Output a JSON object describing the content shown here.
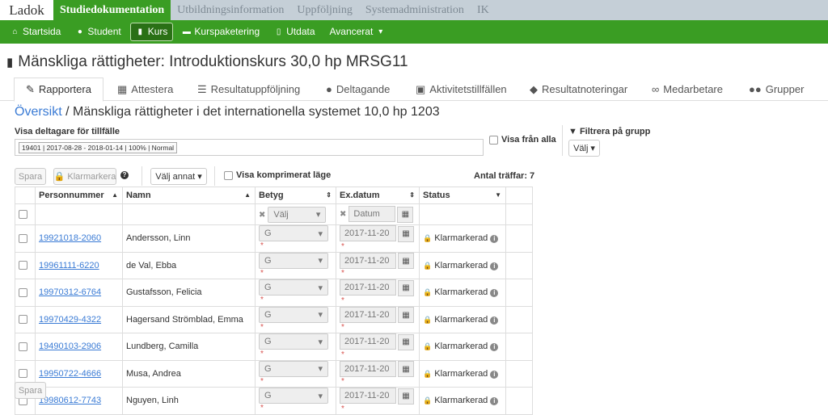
{
  "topnav": {
    "logo": "Ladok",
    "tabs": [
      "Studiedokumentation",
      "Utbildningsinformation",
      "Uppföljning",
      "Systemadministration",
      "IK"
    ]
  },
  "mainnav": {
    "items": [
      {
        "label": "Startsida",
        "icon": "home-icon"
      },
      {
        "label": "Student",
        "icon": "user-icon"
      },
      {
        "label": "Kurs",
        "icon": "book-icon"
      },
      {
        "label": "Kurspaketering",
        "icon": "folder-icon"
      },
      {
        "label": "Utdata",
        "icon": "file-icon"
      },
      {
        "label": "Avancerat",
        "icon": "caret-down-icon"
      }
    ]
  },
  "course_title": "Mänskliga rättigheter: Introduktionskurs 30,0 hp MRSG11",
  "tabs": [
    {
      "label": "Rapportera"
    },
    {
      "label": "Attestera"
    },
    {
      "label": "Resultatuppföljning"
    },
    {
      "label": "Deltagande"
    },
    {
      "label": "Aktivitetstillfällen"
    },
    {
      "label": "Resultatnoteringar"
    },
    {
      "label": "Medarbetare"
    },
    {
      "label": "Grupper"
    }
  ],
  "breadcrumb": {
    "link": "Översikt",
    "separator": " / ",
    "current": "Mänskliga rättigheter i det internationella systemet 10,0 hp 1203"
  },
  "filters": {
    "occasion_label": "Visa deltagare för tillfälle",
    "occasion_value": "19401 | 2017-08-28 - 2018-01-14 | 100% | Normal",
    "show_all_label": "Visa från alla",
    "group_filter_label": "Filtrera på grupp",
    "group_select": "Välj"
  },
  "toolbar": {
    "save": "Spara",
    "mark_ready": "Klarmarkera",
    "choose_other": "Välj annat",
    "compressed_label": "Visa komprimerat läge",
    "hits": "Antal träffar: 7"
  },
  "table": {
    "headers": {
      "person": "Personnummer",
      "name": "Namn",
      "grade": "Betyg",
      "date": "Ex.datum",
      "status": "Status"
    },
    "filter_row": {
      "grade_placeholder": "Välj",
      "date_placeholder": "Datum"
    },
    "rows": [
      {
        "pnr": "19921018-2060",
        "name": "Andersson, Linn",
        "grade": "G",
        "date": "2017-11-20",
        "status": "Klarmarkerad"
      },
      {
        "pnr": "19961111-6220",
        "name": "de Val, Ebba",
        "grade": "G",
        "date": "2017-11-20",
        "status": "Klarmarkerad"
      },
      {
        "pnr": "19970312-6764",
        "name": "Gustafsson, Felicia",
        "grade": "G",
        "date": "2017-11-20",
        "status": "Klarmarkerad"
      },
      {
        "pnr": "19970429-4322",
        "name": "Hagersand Strömblad, Emma",
        "grade": "G",
        "date": "2017-11-20",
        "status": "Klarmarkerad"
      },
      {
        "pnr": "19490103-2906",
        "name": "Lundberg, Camilla",
        "grade": "G",
        "date": "2017-11-20",
        "status": "Klarmarkerad"
      },
      {
        "pnr": "19950722-4666",
        "name": "Musa, Andrea",
        "grade": "G",
        "date": "2017-11-20",
        "status": "Klarmarkerad"
      },
      {
        "pnr": "19980612-7743",
        "name": "Nguyen, Linh",
        "grade": "G",
        "date": "2017-11-20",
        "status": "Klarmarkerad"
      }
    ]
  },
  "footer": {
    "save": "Spara"
  },
  "colors": {
    "green": "#3a9d23",
    "topbar": "#c5cfd7",
    "link": "#3a7bd5"
  }
}
